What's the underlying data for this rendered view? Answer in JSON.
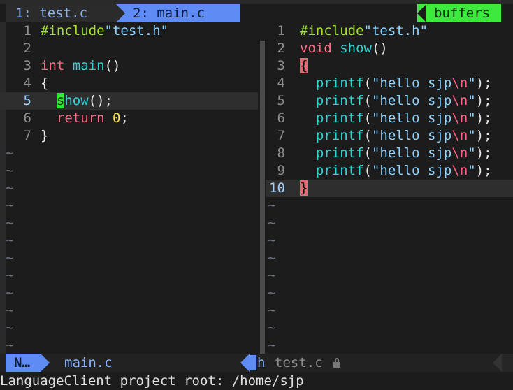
{
  "tabline": {
    "tab1": "1: test.c",
    "tab2": "2: main.c",
    "buffers": "buffers"
  },
  "left_pane": {
    "lines": [
      {
        "num": "1",
        "parts": [
          [
            "#include",
            "inc"
          ],
          [
            "\"test.h\"",
            "str"
          ]
        ]
      },
      {
        "num": "2",
        "parts": []
      },
      {
        "num": "3",
        "parts": [
          [
            "int",
            "type"
          ],
          [
            " ",
            "punc"
          ],
          [
            "main",
            "fn"
          ],
          [
            "()",
            "punc"
          ]
        ]
      },
      {
        "num": "4",
        "parts": [
          [
            "{",
            "punc"
          ]
        ]
      },
      {
        "num": "5",
        "cursor": true,
        "parts": [
          [
            "  ",
            "punc"
          ],
          [
            "s",
            "cursor"
          ],
          [
            "how",
            "fn"
          ],
          [
            "();",
            "punc"
          ]
        ]
      },
      {
        "num": "6",
        "parts": [
          [
            "  ",
            "punc"
          ],
          [
            "return",
            "type"
          ],
          [
            " ",
            "punc"
          ],
          [
            "0",
            "num"
          ],
          [
            ";",
            "punc"
          ]
        ]
      },
      {
        "num": "7",
        "parts": [
          [
            "}",
            "punc"
          ]
        ]
      }
    ],
    "tilde_count": 12
  },
  "right_pane": {
    "lines": [
      {
        "num": "1",
        "parts": [
          [
            "#include",
            "inc"
          ],
          [
            "\"test.h\"",
            "str"
          ]
        ]
      },
      {
        "num": "2",
        "parts": [
          [
            "void",
            "type"
          ],
          [
            " ",
            "punc"
          ],
          [
            "show",
            "fn"
          ],
          [
            "()",
            "punc"
          ]
        ]
      },
      {
        "num": "3",
        "parts": [
          [
            "{",
            "brace"
          ]
        ]
      },
      {
        "num": "4",
        "parts": [
          [
            "  ",
            "punc"
          ],
          [
            "printf",
            "fn"
          ],
          [
            "(",
            "punc"
          ],
          [
            "\"hello sjp",
            "str"
          ],
          [
            "\\n",
            "esc"
          ],
          [
            "\"",
            "str"
          ],
          [
            ");",
            "punc"
          ]
        ]
      },
      {
        "num": "5",
        "parts": [
          [
            "  ",
            "punc"
          ],
          [
            "printf",
            "fn"
          ],
          [
            "(",
            "punc"
          ],
          [
            "\"hello sjp",
            "str"
          ],
          [
            "\\n",
            "esc"
          ],
          [
            "\"",
            "str"
          ],
          [
            ");",
            "punc"
          ]
        ]
      },
      {
        "num": "6",
        "parts": [
          [
            "  ",
            "punc"
          ],
          [
            "printf",
            "fn"
          ],
          [
            "(",
            "punc"
          ],
          [
            "\"hello sjp",
            "str"
          ],
          [
            "\\n",
            "esc"
          ],
          [
            "\"",
            "str"
          ],
          [
            ");",
            "punc"
          ]
        ]
      },
      {
        "num": "7",
        "parts": [
          [
            "  ",
            "punc"
          ],
          [
            "printf",
            "fn"
          ],
          [
            "(",
            "punc"
          ],
          [
            "\"hello sjp",
            "str"
          ],
          [
            "\\n",
            "esc"
          ],
          [
            "\"",
            "str"
          ],
          [
            ");",
            "punc"
          ]
        ]
      },
      {
        "num": "8",
        "parts": [
          [
            "  ",
            "punc"
          ],
          [
            "printf",
            "fn"
          ],
          [
            "(",
            "punc"
          ],
          [
            "\"hello sjp",
            "str"
          ],
          [
            "\\n",
            "esc"
          ],
          [
            "\"",
            "str"
          ],
          [
            ");",
            "punc"
          ]
        ]
      },
      {
        "num": "9",
        "parts": [
          [
            "  ",
            "punc"
          ],
          [
            "printf",
            "fn"
          ],
          [
            "(",
            "punc"
          ],
          [
            "\"hello sjp",
            "str"
          ],
          [
            "\\n",
            "esc"
          ],
          [
            "\"",
            "str"
          ],
          [
            ");",
            "punc"
          ]
        ]
      },
      {
        "num": "10",
        "cursor": true,
        "parts": [
          [
            "}",
            "brace"
          ]
        ]
      }
    ],
    "tilde_count": 9
  },
  "statusline": {
    "mode": "N…",
    "left_file": "main.c",
    "right_letter": "h",
    "right_file": "test.c",
    "lock_icon": "lock-icon"
  },
  "cmdline": "LanguageClient project root: /home/sjp"
}
